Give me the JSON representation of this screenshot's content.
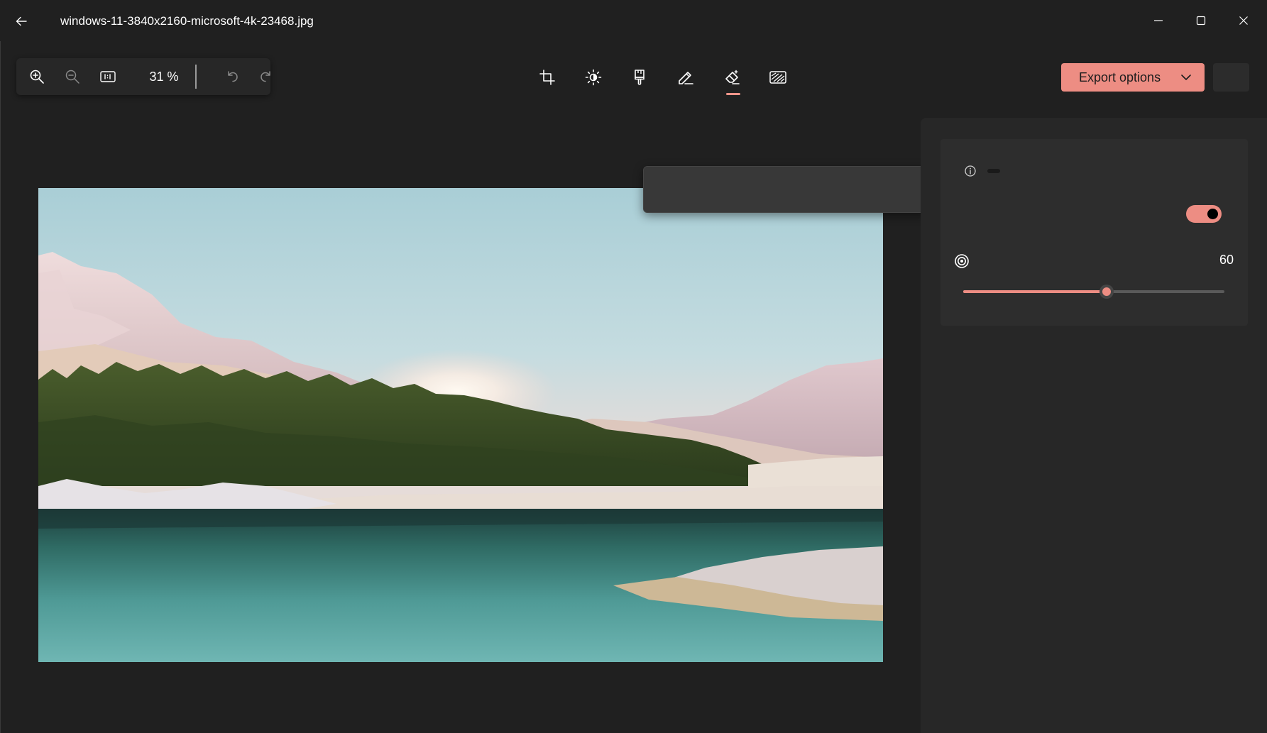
{
  "titlebar": {
    "filename": "windows-11-3840x2160-microsoft-4k-23468.jpg",
    "back_icon": "back-arrow-icon",
    "minimize_icon": "minimize-icon",
    "maximize_icon": "maximize-icon",
    "close_icon": "close-icon"
  },
  "zoombar": {
    "zoom_in_icon": "zoom-in-icon",
    "zoom_out_icon": "zoom-out-icon",
    "actual_size_icon": "actual-size-icon",
    "zoom_level": "31 %",
    "undo_icon": "undo-icon",
    "redo_icon": "redo-icon"
  },
  "tools": [
    {
      "name": "crop",
      "icon": "crop-icon"
    },
    {
      "name": "adjustment",
      "icon": "brightness-icon"
    },
    {
      "name": "filter",
      "icon": "filter-brush-icon"
    },
    {
      "name": "markup",
      "icon": "pen-icon"
    },
    {
      "name": "erase",
      "icon": "eraser-icon",
      "active": true
    },
    {
      "name": "background",
      "icon": "background-blur-icon"
    }
  ],
  "export": {
    "label": "Export options",
    "chevron_icon": "chevron-down-icon"
  },
  "panel": {
    "info_icon": "info-icon",
    "toggle_on": true,
    "brush_size_icon": "brush-size-icon",
    "brush_size_value": "60",
    "brush_size_fraction": 0.55
  },
  "colors": {
    "accent": "#ed8d83",
    "background": "#202020",
    "panel": "#272727",
    "card": "#2d2d2d"
  }
}
